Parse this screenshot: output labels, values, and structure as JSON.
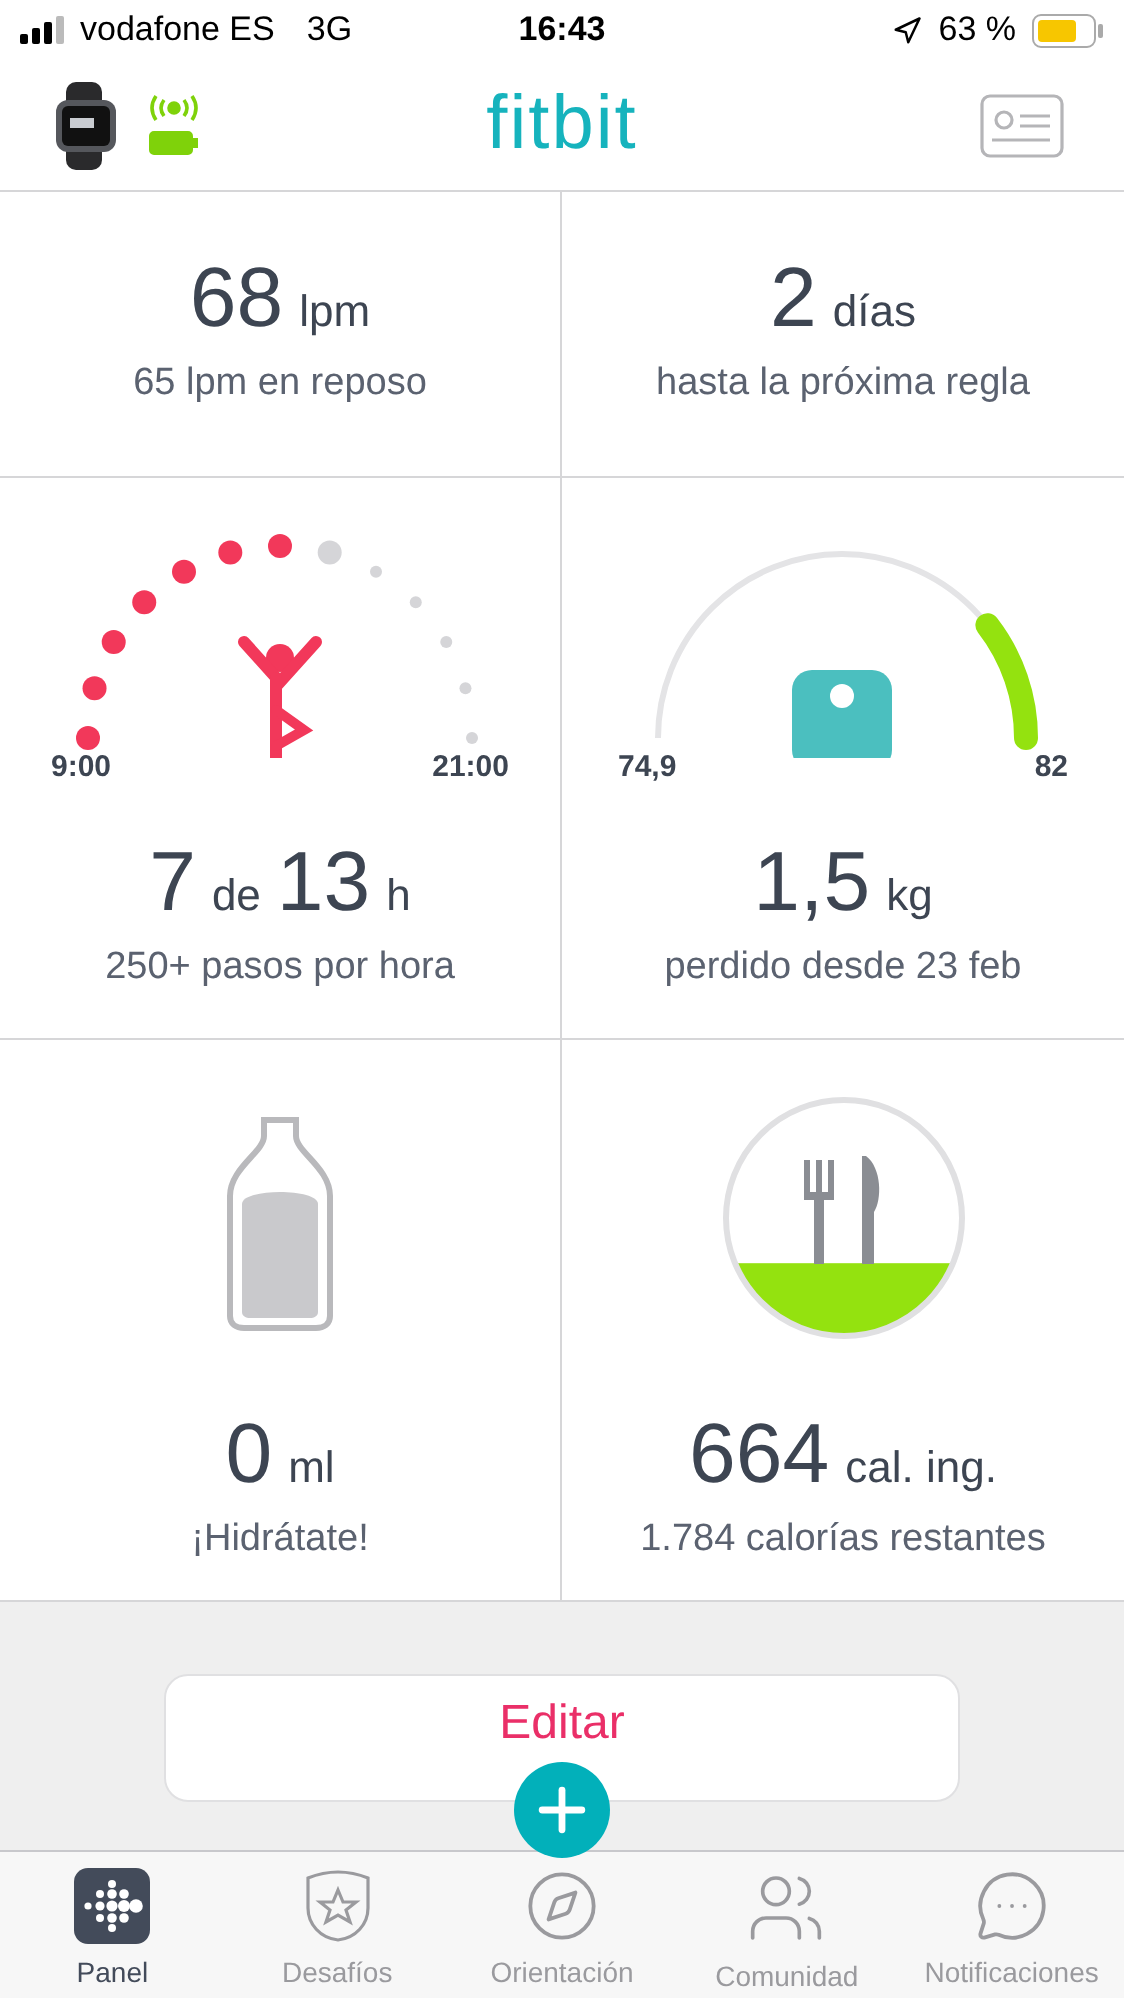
{
  "status_bar": {
    "carrier": "vodafone ES",
    "network": "3G",
    "time": "16:43",
    "battery": "63 %"
  },
  "header": {
    "logo": "fitbit"
  },
  "tiles": [
    {
      "kind": "heart",
      "value": [
        {
          "text": "68",
          "kind": "big"
        },
        {
          "text": "lpm",
          "kind": "small"
        }
      ],
      "caption": "65 lpm en reposo"
    },
    {
      "kind": "cycle",
      "value": [
        {
          "text": "2",
          "kind": "big"
        },
        {
          "text": "días",
          "kind": "small"
        }
      ],
      "caption": "hasta la próxima regla"
    },
    {
      "kind": "hourly",
      "start": "9:00",
      "end": "21:00",
      "hours": [
        {
          "kind": "done"
        },
        {
          "kind": "done"
        },
        {
          "kind": "done"
        },
        {
          "kind": "done"
        },
        {
          "kind": "done"
        },
        {
          "kind": "done"
        },
        {
          "kind": "done"
        },
        {
          "kind": "current"
        },
        {
          "kind": "pending"
        },
        {
          "kind": "pending"
        },
        {
          "kind": "pending"
        },
        {
          "kind": "pending"
        },
        {
          "kind": "pending"
        }
      ],
      "value": [
        {
          "text": "7",
          "kind": "big"
        },
        {
          "text": "de",
          "kind": "small"
        },
        {
          "text": "13",
          "kind": "big"
        },
        {
          "text": "h",
          "kind": "small"
        }
      ],
      "caption": "250+ pasos por hora"
    },
    {
      "kind": "weight",
      "start": "74,9",
      "end": "82",
      "value": [
        {
          "text": "1,5",
          "kind": "big"
        },
        {
          "text": "kg",
          "kind": "small"
        }
      ],
      "caption": "perdido desde 23 feb"
    },
    {
      "kind": "water",
      "value": [
        {
          "text": "0",
          "kind": "big"
        },
        {
          "text": "ml",
          "kind": "small"
        }
      ],
      "caption": "¡Hidrátate!"
    },
    {
      "kind": "food",
      "value": [
        {
          "text": "664",
          "kind": "big"
        },
        {
          "text": "cal. ing.",
          "kind": "small"
        }
      ],
      "caption": "1.784 calorías restantes"
    }
  ],
  "edit_button": "Editar",
  "tabs": [
    {
      "label": "Panel",
      "selected": true
    },
    {
      "label": "Desafíos",
      "selected": false
    },
    {
      "label": "Orientación",
      "selected": false
    },
    {
      "label": "Comunidad",
      "selected": false
    },
    {
      "label": "Notificaciones",
      "selected": false
    }
  ]
}
